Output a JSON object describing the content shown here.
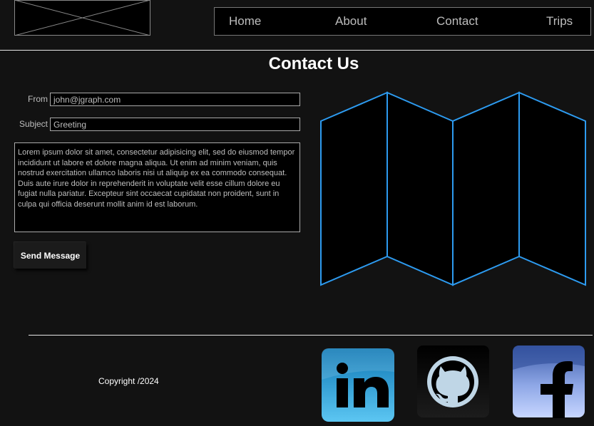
{
  "nav": {
    "items": [
      {
        "label": "Home"
      },
      {
        "label": "About"
      },
      {
        "label": "Contact"
      },
      {
        "label": "Trips"
      }
    ]
  },
  "page": {
    "title": "Contact Us"
  },
  "form": {
    "from_label": "From",
    "from_value": "john@jgraph.com",
    "subject_label": "Subject",
    "subject_value": "Greeting",
    "message": "Lorem ipsum dolor sit amet, consectetur adipisicing elit, sed do eiusmod tempor incididunt ut labore et dolore magna aliqua. Ut enim ad minim veniam, quis nostrud exercitation ullamco laboris nisi ut aliquip ex ea commodo consequat. Duis aute irure dolor in reprehenderit in voluptate velit esse cillum dolore eu fugiat nulla pariatur. Excepteur sint occaecat cupidatat non proident, sunt in culpa qui officia deserunt mollit anim id est laborum.",
    "send_label": "Send Message"
  },
  "map": {
    "icon": "folded-map-icon",
    "stroke_color": "#2d9bf0"
  },
  "footer": {
    "copyright": "Copyright /2024",
    "social": [
      {
        "icon": "linkedin-icon"
      },
      {
        "icon": "github-icon"
      },
      {
        "icon": "facebook-icon"
      }
    ]
  },
  "colors": {
    "background": "#121212",
    "accent": "#2d9bf0"
  }
}
